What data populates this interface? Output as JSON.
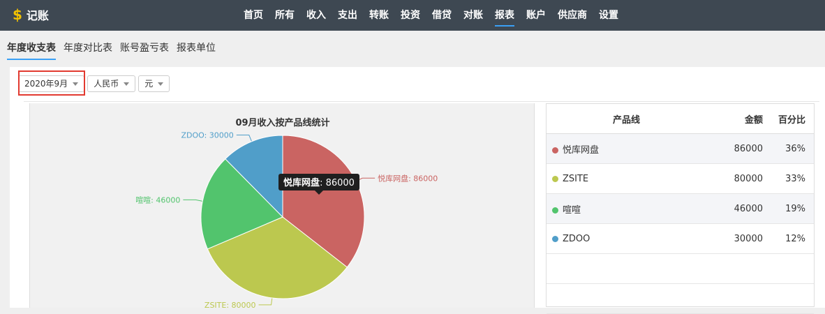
{
  "app": {
    "title": "记账",
    "logo_icon": "$"
  },
  "nav": {
    "items": [
      "首页",
      "所有",
      "收入",
      "支出",
      "转账",
      "投资",
      "借贷",
      "对账",
      "报表",
      "账户",
      "供应商",
      "设置"
    ],
    "active": "报表"
  },
  "subtabs": {
    "items": [
      "年度收支表",
      "年度对比表",
      "账号盈亏表",
      "报表单位"
    ],
    "active": "年度收支表"
  },
  "filters": {
    "month": "2020年9月",
    "currency": "人民币",
    "unit": "元"
  },
  "chart_data": {
    "type": "pie",
    "title": "09月收入按产品线统计",
    "slices": [
      {
        "name": "悦库网盘",
        "value": 86000,
        "color": "#ca6462",
        "label": "悦库网盘: 86000"
      },
      {
        "name": "ZSITE",
        "value": 80000,
        "color": "#bcc84f",
        "label": "ZSITE: 80000"
      },
      {
        "name": "喧喧",
        "value": 46000,
        "color": "#52c46d",
        "label": "喧喧: 46000"
      },
      {
        "name": "ZDOO",
        "value": 30000,
        "color": "#509ec9",
        "label": "ZDOO: 30000"
      }
    ],
    "tooltip": {
      "name": "悦库网盘",
      "value": "86000"
    }
  },
  "table": {
    "headers": {
      "name": "产品线",
      "amount": "金额",
      "percent": "百分比"
    },
    "rows": [
      {
        "name": "悦库网盘",
        "amount": "86000",
        "percent": "36%",
        "color": "#ca6462"
      },
      {
        "name": "ZSITE",
        "amount": "80000",
        "percent": "33%",
        "color": "#bcc84f"
      },
      {
        "name": "喧喧",
        "amount": "46000",
        "percent": "19%",
        "color": "#52c46d"
      },
      {
        "name": "ZDOO",
        "amount": "30000",
        "percent": "12%",
        "color": "#509ec9"
      }
    ]
  }
}
